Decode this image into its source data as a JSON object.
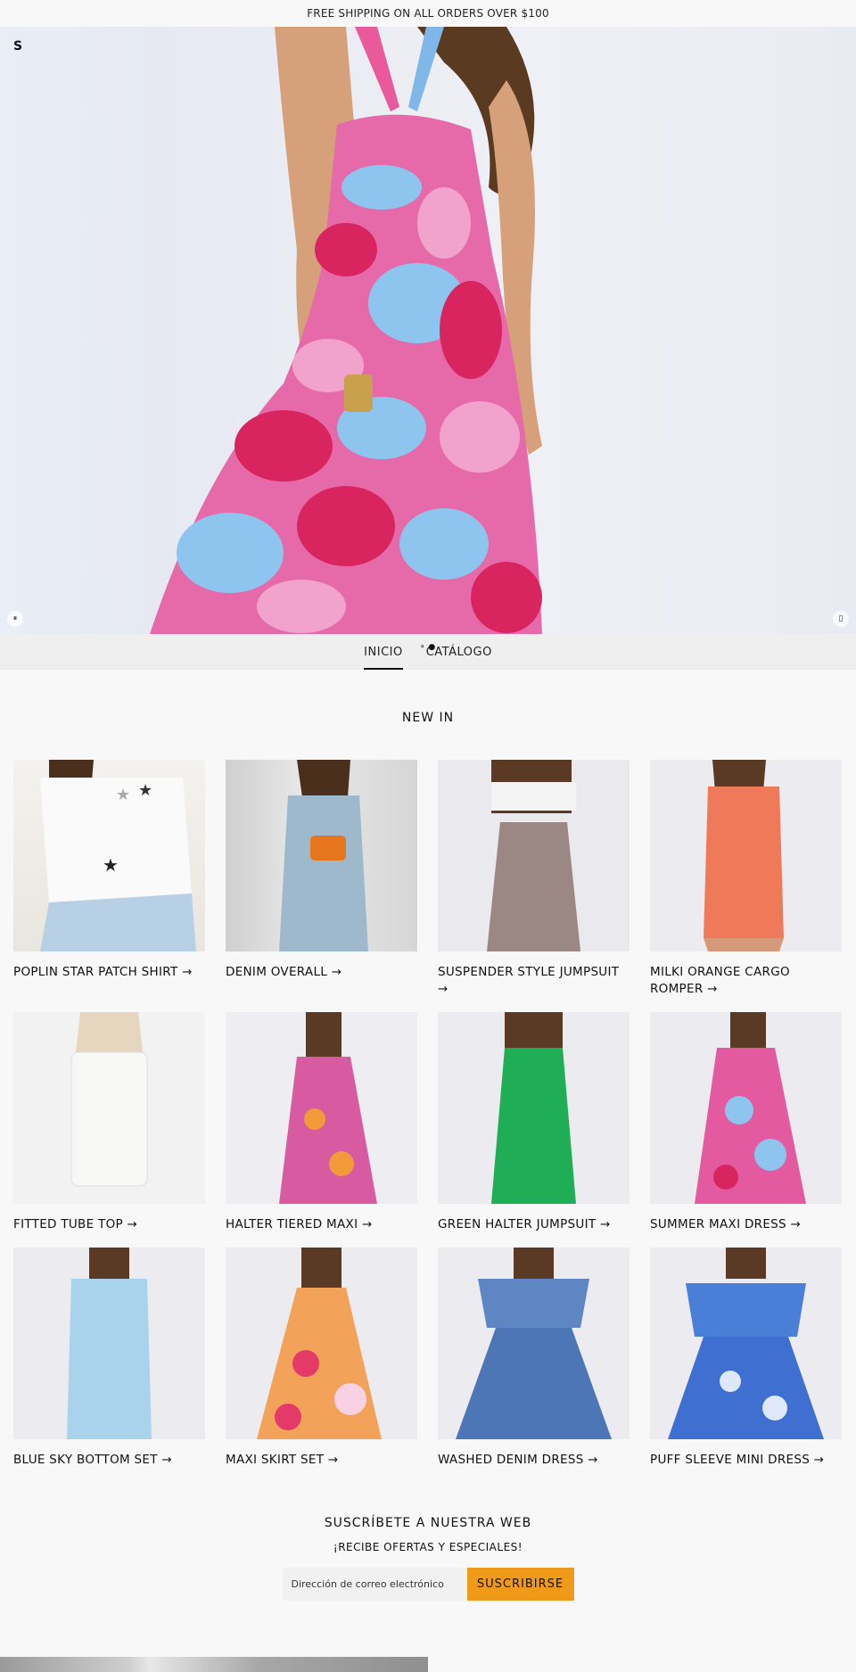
{
  "announcement": "FREE SHIPPING ON ALL ORDERS OVER $100",
  "hero": {
    "logo": "S"
  },
  "nav": {
    "items": [
      {
        "label": "INICIO"
      },
      {
        "label": "CATÁLOGO"
      }
    ]
  },
  "new_in": {
    "title": "NEW IN"
  },
  "products": [
    {
      "name": "POPLIN STAR PATCH SHIRT →"
    },
    {
      "name": "DENIM OVERALL →"
    },
    {
      "name": "SUSPENDER STYLE JUMPSUIT →"
    },
    {
      "name": "MILKI ORANGE CARGO ROMPER →"
    },
    {
      "name": "FITTED TUBE TOP →"
    },
    {
      "name": "HALTER TIERED MAXI →"
    },
    {
      "name": "GREEN HALTER JUMPSUIT →"
    },
    {
      "name": "SUMMER MAXI DRESS →"
    },
    {
      "name": "BLUE SKY BOTTOM SET →"
    },
    {
      "name": "MAXI SKIRT SET →"
    },
    {
      "name": "WASHED DENIM DRESS →"
    },
    {
      "name": "PUFF SLEEVE MINI DRESS →"
    }
  ],
  "newsletter": {
    "title": "SUSCRÍBETE A NUESTRA WEB",
    "subtitle": "¡RECIBE OFERTAS Y ESPECIALES!",
    "placeholder": "Dirección de correo electrónico",
    "button": "SUSCRIBIRSE"
  },
  "colors": {
    "accent": "#f09a1a",
    "background": "#f8f8f8"
  }
}
